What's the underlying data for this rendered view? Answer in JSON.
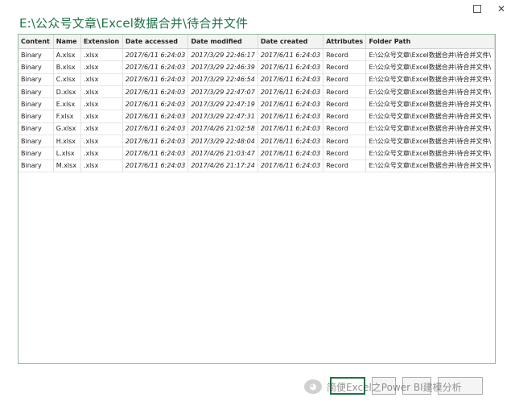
{
  "window": {
    "maximize_icon": "maximize-icon",
    "close_glyph": "✕"
  },
  "title": "E:\\公众号文章\\Excel数据合并\\待合并文件",
  "table": {
    "headers": [
      "Content",
      "Name",
      "Extension",
      "Date accessed",
      "Date modified",
      "Date created",
      "Attributes",
      "Folder Path"
    ],
    "rows": [
      [
        "Binary",
        "A.xlsx",
        ".xlsx",
        "2017/6/11 6:24:03",
        "2017/3/29 22:46:17",
        "2017/6/11 6:24:03",
        "Record",
        "E:\\公众号文章\\Excel数据合并\\待合并文件\\"
      ],
      [
        "Binary",
        "B.xlsx",
        ".xlsx",
        "2017/6/11 6:24:03",
        "2017/3/29 22:46:39",
        "2017/6/11 6:24:03",
        "Record",
        "E:\\公众号文章\\Excel数据合并\\待合并文件\\"
      ],
      [
        "Binary",
        "C.xlsx",
        ".xlsx",
        "2017/6/11 6:24:03",
        "2017/3/29 22:46:54",
        "2017/6/11 6:24:03",
        "Record",
        "E:\\公众号文章\\Excel数据合并\\待合并文件\\"
      ],
      [
        "Binary",
        "D.xlsx",
        ".xlsx",
        "2017/6/11 6:24:03",
        "2017/3/29 22:47:07",
        "2017/6/11 6:24:03",
        "Record",
        "E:\\公众号文章\\Excel数据合并\\待合并文件\\"
      ],
      [
        "Binary",
        "E.xlsx",
        ".xlsx",
        "2017/6/11 6:24:03",
        "2017/3/29 22:47:19",
        "2017/6/11 6:24:03",
        "Record",
        "E:\\公众号文章\\Excel数据合并\\待合并文件\\"
      ],
      [
        "Binary",
        "F.xlsx",
        ".xlsx",
        "2017/6/11 6:24:03",
        "2017/3/29 22:47:31",
        "2017/6/11 6:24:03",
        "Record",
        "E:\\公众号文章\\Excel数据合并\\待合并文件\\"
      ],
      [
        "Binary",
        "G.xlsx",
        ".xlsx",
        "2017/6/11 6:24:03",
        "2017/4/26 21:02:58",
        "2017/6/11 6:24:03",
        "Record",
        "E:\\公众号文章\\Excel数据合并\\待合并文件\\"
      ],
      [
        "Binary",
        "H.xlsx",
        ".xlsx",
        "2017/6/11 6:24:03",
        "2017/3/29 22:48:04",
        "2017/6/11 6:24:03",
        "Record",
        "E:\\公众号文章\\Excel数据合并\\待合并文件\\"
      ],
      [
        "Binary",
        "L.xlsx",
        ".xlsx",
        "2017/6/11 6:24:03",
        "2017/4/26 21:03:47",
        "2017/6/11 6:24:03",
        "Record",
        "E:\\公众号文章\\Excel数据合并\\待合并文件\\"
      ],
      [
        "Binary",
        "M.xlsx",
        ".xlsx",
        "2017/6/11 6:24:03",
        "2017/4/26 21:17:24",
        "2017/6/11 6:24:03",
        "Record",
        "E:\\公众号文章\\Excel数据合并\\待合并文件\\"
      ]
    ]
  },
  "buttons": [
    {
      "label": "",
      "primary": true
    },
    {
      "label": ""
    },
    {
      "label": ""
    },
    {
      "label": ""
    }
  ],
  "watermark": {
    "text": "简便Excel之Power BI建模分析",
    "logo_icon": "wechat-logo-icon"
  },
  "colors": {
    "accent": "#217346",
    "frame_border": "#8fb99d"
  }
}
